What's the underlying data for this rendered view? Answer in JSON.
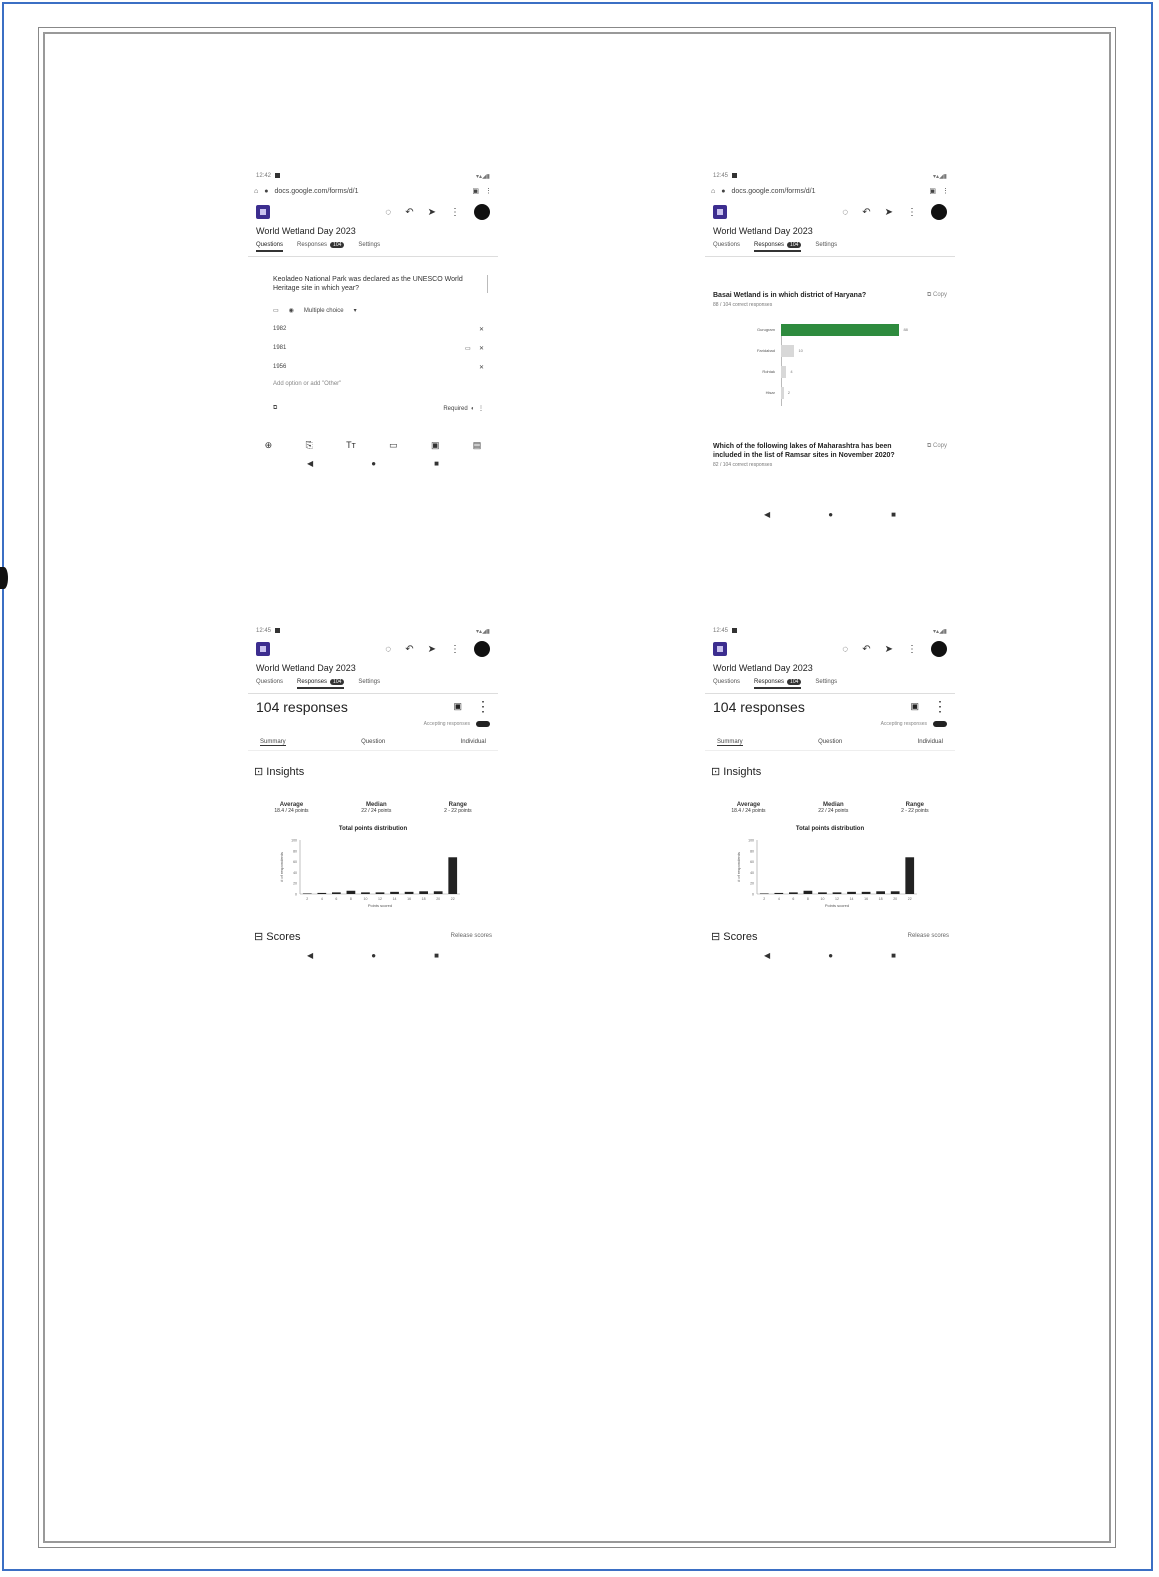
{
  "accent_color": "#3c2d8f",
  "bar_green": "#2e8b3e",
  "screens": [
    {
      "status_time": "12:42",
      "url": "docs.google.com/forms/d/1",
      "form_title": "World Wetland Day 2023",
      "tabs": {
        "questions": "Questions",
        "responses": "Responses",
        "responses_count": "104",
        "settings": "Settings"
      },
      "question": "Keoladeo National Park was declared as the UNESCO World Heritage site in which year?",
      "question_type": "Multiple choice",
      "options": [
        "1982",
        "1981",
        "1956"
      ],
      "add_option": "Add option or add \"Other\"",
      "required": "Required",
      "bottom_tools": [
        "⊕",
        "⎘",
        "Tт",
        "▭",
        "▣",
        "▤"
      ]
    },
    {
      "status_time": "12:45",
      "url": "docs.google.com/forms/d/1",
      "form_title": "World Wetland Day 2023",
      "tabs": {
        "questions": "Questions",
        "responses": "Responses",
        "responses_count": "104",
        "settings": "Settings"
      },
      "question": "Basai Wetland is in which district of Haryana?",
      "copy": "Copy",
      "correct": "88 / 104 correct responses",
      "question2": "Which of the following lakes of Maharashtra has been included in the list of Ramsar sites in November 2020?",
      "correct2": "82 / 104 correct responses",
      "chart_data": {
        "type": "bar",
        "orientation": "horizontal",
        "categories": [
          "Gurugram",
          "Faridabad",
          "Rohtak",
          "Hisar"
        ],
        "values": [
          88,
          10,
          4,
          2
        ],
        "xlim": [
          0,
          104
        ],
        "correct_color": "#2e8b3e",
        "other_color": "#d8d8d8"
      }
    },
    {
      "status_time": "12:45",
      "form_title": "World Wetland Day 2023",
      "tabs": {
        "questions": "Questions",
        "responses": "Responses",
        "responses_count": "104",
        "settings": "Settings"
      },
      "responses_title": "104 responses",
      "accepting": "Accepting responses",
      "subtabs": [
        "Summary",
        "Question",
        "Individual"
      ],
      "insights": "Insights",
      "average_label": "Average",
      "average_value": "18.4 / 24 points",
      "median_label": "Median",
      "median_value": "22 / 24 points",
      "range_label": "Range",
      "range_value": "2 - 22 points",
      "chart_title": "Total points distribution",
      "scores": "Scores",
      "release": "Release scores"
    },
    {
      "status_time": "12:45",
      "form_title": "World Wetland Day 2023",
      "tabs": {
        "questions": "Questions",
        "responses": "Responses",
        "responses_count": "104",
        "settings": "Settings"
      },
      "responses_title": "104 responses",
      "accepting": "Accepting responses",
      "subtabs": [
        "Summary",
        "Question",
        "Individual"
      ],
      "insights": "Insights",
      "average_label": "Average",
      "average_value": "18.4 / 24 points",
      "median_label": "Median",
      "median_value": "22 / 24 points",
      "range_label": "Range",
      "range_value": "2 - 22 points",
      "chart_title": "Total points distribution",
      "scores": "Scores",
      "release": "Release scores"
    }
  ],
  "chart_data": [
    {
      "type": "bar",
      "title": "Total points distribution",
      "xlabel": "Points scored",
      "ylabel": "# of respondents",
      "categories": [
        "2",
        "4",
        "6",
        "8",
        "10",
        "12",
        "14",
        "16",
        "18",
        "20",
        "22"
      ],
      "values": [
        1,
        2,
        3,
        6,
        3,
        3,
        4,
        4,
        5,
        5,
        68
      ],
      "ylim": [
        0,
        100
      ],
      "color": "#222222"
    },
    {
      "type": "bar",
      "title": "Total points distribution",
      "xlabel": "Points scored",
      "ylabel": "# of respondents",
      "categories": [
        "2",
        "4",
        "6",
        "8",
        "10",
        "12",
        "14",
        "16",
        "18",
        "20",
        "22"
      ],
      "values": [
        1,
        2,
        3,
        6,
        3,
        3,
        4,
        4,
        5,
        5,
        68
      ],
      "ylim": [
        0,
        100
      ],
      "color": "#222222"
    }
  ]
}
